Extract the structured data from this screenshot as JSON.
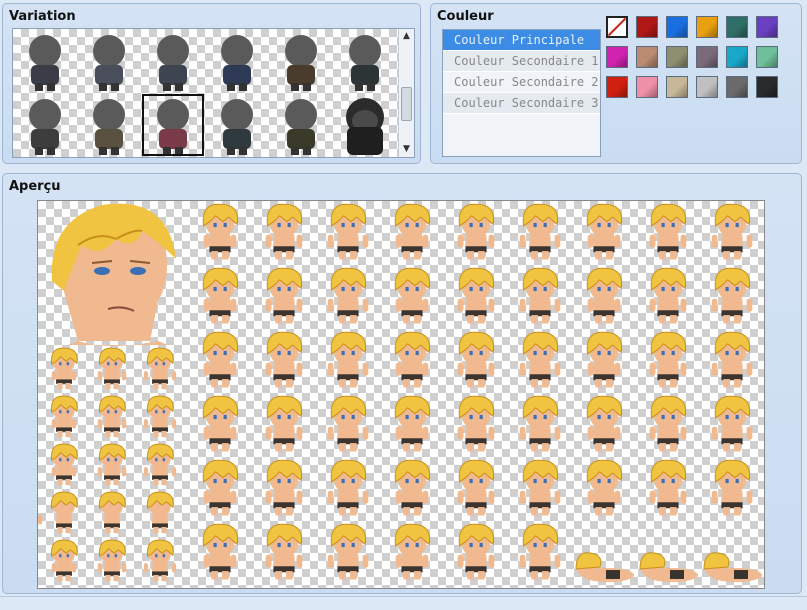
{
  "variation": {
    "title": "Variation",
    "cells_row1": 6,
    "cells_row2": 6,
    "selected_index": 8
  },
  "couleur": {
    "title": "Couleur",
    "items": [
      "Couleur Principale",
      "Couleur Secondaire 1",
      "Couleur Secondaire 2",
      "Couleur Secondaire 3"
    ],
    "active_index": 0,
    "swatches": [
      "none",
      "#b01818",
      "#1a6fe0",
      "#e8a010",
      "#2f6e66",
      "#6a3fc0",
      "#d024b0",
      "#b98c72",
      "#8e8e70",
      "#7a6a7a",
      "#1aa8c8",
      "#6fc09a",
      "#d02010",
      "#f090a8",
      "#c8b89a",
      "#c0c0c0",
      "#6a6a6a",
      "#2a2a2a"
    ]
  },
  "apercu": {
    "title": "Aperçu"
  },
  "colors": {
    "skin": "#f1b98f",
    "hair": "#f0c440",
    "hair_dark": "#c8901a",
    "shorts": "#3a3430",
    "silhouette": "#5a5a5a"
  }
}
